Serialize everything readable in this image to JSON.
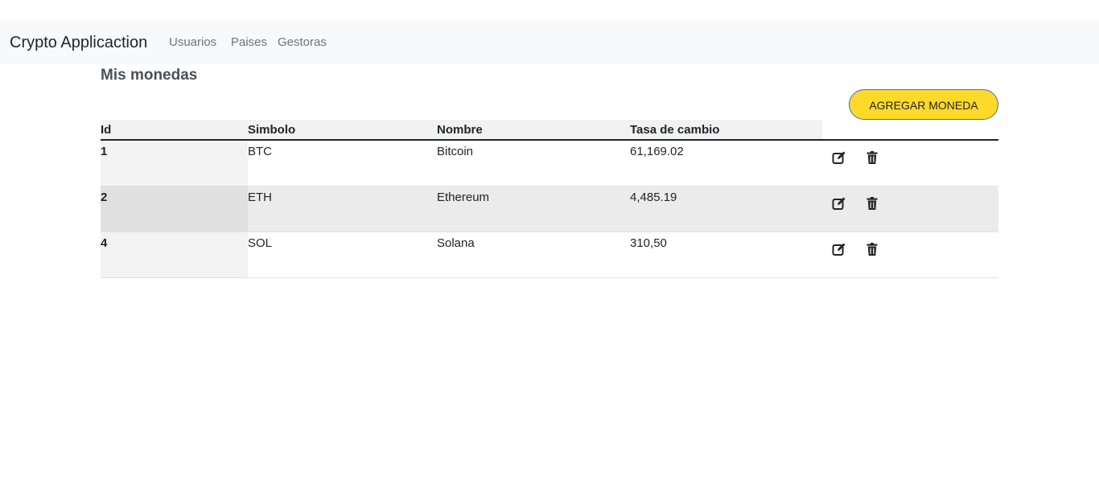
{
  "navbar": {
    "brand": "Crypto Applicaction",
    "links": [
      "Usuarios",
      "Paises",
      "Gestoras"
    ]
  },
  "page": {
    "title": "Mis monedas",
    "add_button_label": "AGREGAR MONEDA"
  },
  "table": {
    "columns": [
      "Id",
      "Simbolo",
      "Nombre",
      "Tasa de cambio"
    ],
    "rows": [
      {
        "id": "1",
        "symbol": "BTC",
        "name": "Bitcoin",
        "rate": "61,169.02"
      },
      {
        "id": "2",
        "symbol": "ETH",
        "name": "Ethereum",
        "rate": "4,485.19"
      },
      {
        "id": "4",
        "symbol": "SOL",
        "name": "Solana",
        "rate": "310,50"
      }
    ],
    "row_actions": {
      "edit_icon": "edit-icon",
      "delete_icon": "trash-icon"
    }
  },
  "colors": {
    "navbar_bg": "#f8f9fa",
    "button_bg": "#fdd92a",
    "button_border": "#3b73b9",
    "nav_link": "#6c757d"
  }
}
